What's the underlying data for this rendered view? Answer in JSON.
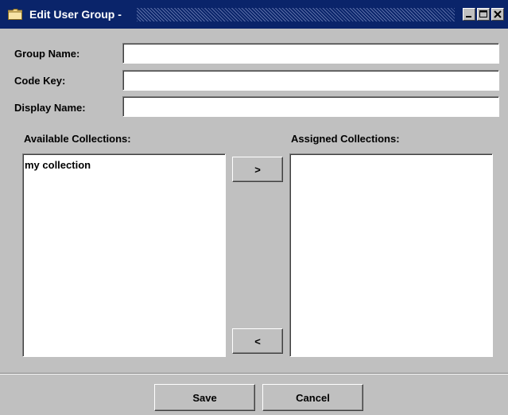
{
  "window": {
    "title": "Edit User Group -",
    "icon": "folder-icon",
    "controls": {
      "minimize": "minimize-icon",
      "maximize": "maximize-icon",
      "close": "close-icon"
    }
  },
  "form": {
    "group_name_label": "Group Name:",
    "group_name_value": "",
    "code_key_label": "Code Key:",
    "code_key_value": "",
    "display_name_label": "Display Name:",
    "display_name_value": ""
  },
  "available": {
    "label": "Available Collections:",
    "items": [
      "my collection"
    ]
  },
  "assigned": {
    "label": "Assigned Collections:",
    "items": []
  },
  "transfer": {
    "add_label": ">",
    "remove_label": "<"
  },
  "footer": {
    "save_label": "Save",
    "cancel_label": "Cancel"
  },
  "colors": {
    "titlebar": "#0a246a",
    "window_bg": "#c0c0c0"
  }
}
